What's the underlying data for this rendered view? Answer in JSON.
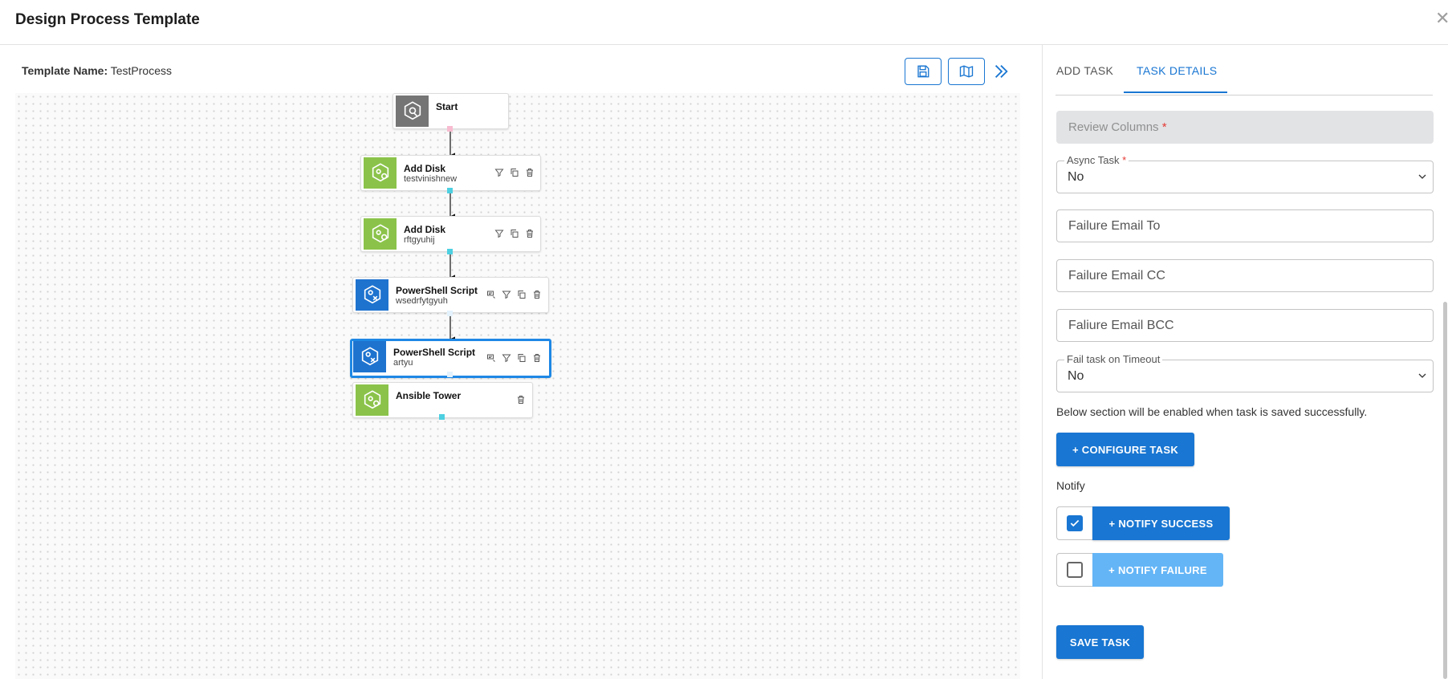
{
  "header": {
    "title": "Design Process Template",
    "close_icon": "close-icon"
  },
  "template": {
    "label": "Template Name:",
    "name": "TestProcess"
  },
  "toolbar": {
    "save_icon": "floppy-disk-icon",
    "map_icon": "map-icon",
    "expand_icon": "double-chevron-right-icon"
  },
  "nodes": [
    {
      "title": "Start",
      "subtitle": "",
      "icon": "start-icon",
      "color": "#757575",
      "actions": []
    },
    {
      "title": "Add Disk",
      "subtitle": "testvinishnew",
      "icon": "hex-gear-icon",
      "color": "#8bc34a",
      "actions": [
        "filter-icon",
        "copy-icon",
        "delete-icon"
      ]
    },
    {
      "title": "Add Disk",
      "subtitle": "rftgyuhij",
      "icon": "hex-gear-icon",
      "color": "#8bc34a",
      "actions": [
        "filter-icon",
        "copy-icon",
        "delete-icon"
      ]
    },
    {
      "title": "PowerShell Script",
      "subtitle": "wsedrfytgyuh",
      "icon": "script-hex-icon",
      "color": "#1e73cf",
      "actions": [
        "edit-list-icon",
        "filter-icon",
        "copy-icon",
        "delete-icon"
      ]
    },
    {
      "title": "PowerShell Script",
      "subtitle": "artyu",
      "icon": "script-hex-icon",
      "color": "#1e73cf",
      "selected": true,
      "actions": [
        "edit-list-icon",
        "filter-icon",
        "copy-icon",
        "delete-icon"
      ]
    },
    {
      "title": "Ansible Tower",
      "subtitle": "",
      "icon": "hex-gear-icon",
      "color": "#8bc34a",
      "actions": [
        "delete-icon"
      ]
    }
  ],
  "tabs": [
    {
      "label": "ADD TASK",
      "active": false
    },
    {
      "label": "TASK DETAILS",
      "active": true
    }
  ],
  "form": {
    "review_columns": {
      "placeholder": "Review Columns",
      "required_mark": "*"
    },
    "async_task": {
      "label": "Async Task",
      "required_mark": "*",
      "value": "No"
    },
    "failure_email_to": {
      "placeholder": "Failure Email To"
    },
    "failure_email_cc": {
      "placeholder": "Failure Email CC"
    },
    "failure_email_bcc": {
      "placeholder": "Faliure Email BCC"
    },
    "fail_on_timeout": {
      "label": "Fail task on Timeout",
      "value": "No"
    },
    "note": "Below section will be enabled when task is saved successfully.",
    "configure_button": "+ CONFIGURE TASK",
    "notify_label": "Notify",
    "notify_success": {
      "label": "+ NOTIFY SUCCESS",
      "checked": true
    },
    "notify_failure": {
      "label": "+ NOTIFY FAILURE",
      "checked": false
    },
    "save_button": "SAVE TASK"
  },
  "colors": {
    "accent": "#1976d2",
    "selected_border": "#1e88e5",
    "port": "#4dd0e1"
  }
}
